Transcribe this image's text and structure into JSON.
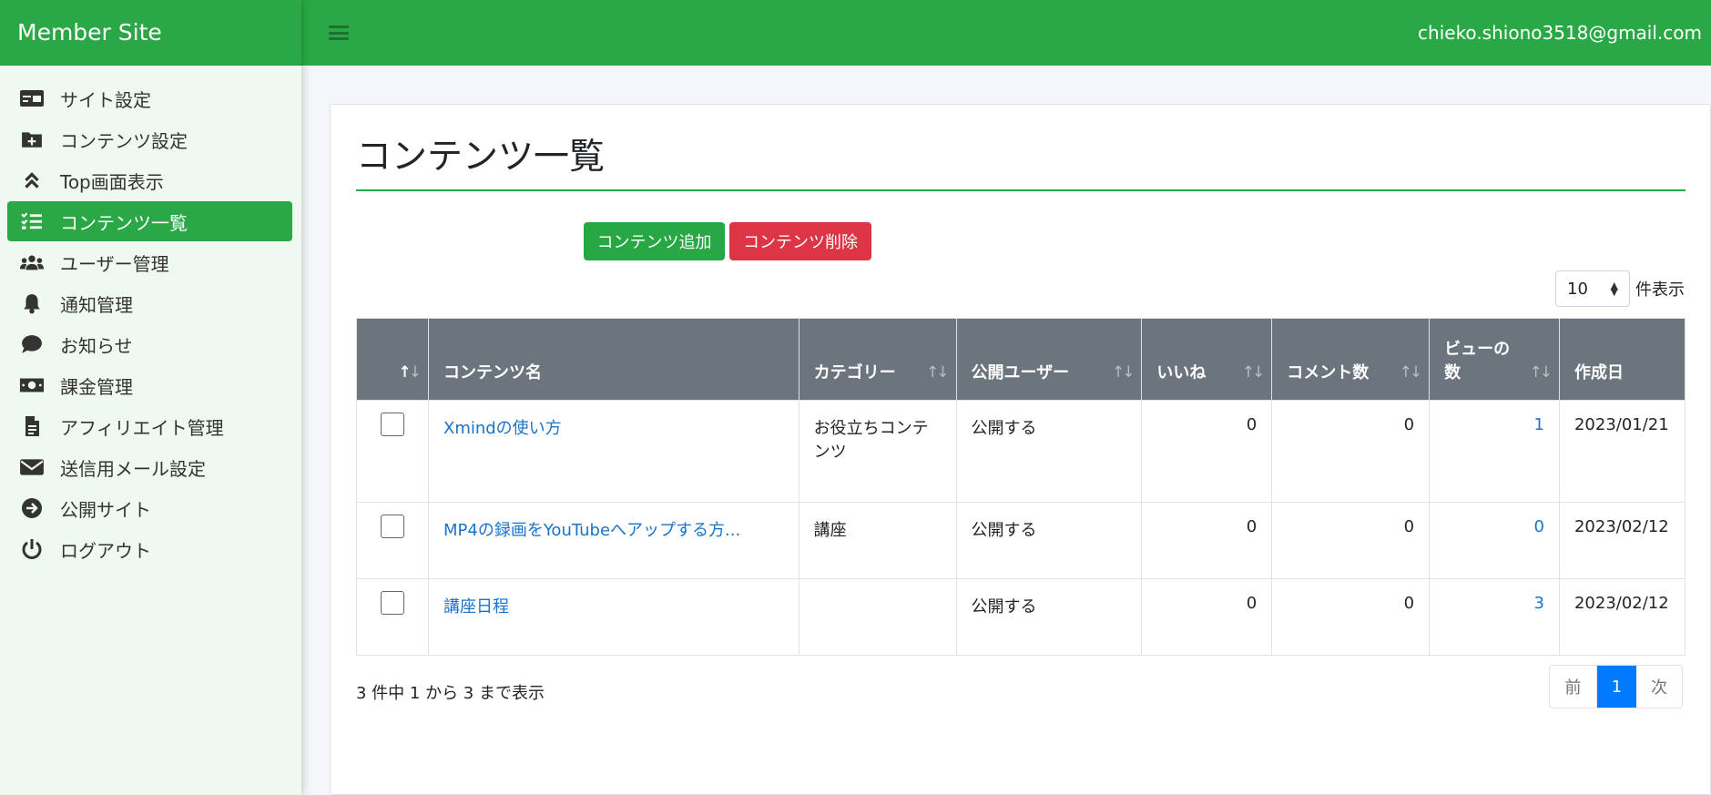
{
  "brand": "Member Site",
  "user_email": "chieko.shiono3518@gmail.com",
  "sidebar": {
    "items": [
      {
        "label": "サイト設定",
        "icon": "card-icon"
      },
      {
        "label": "コンテンツ設定",
        "icon": "folder-plus-icon"
      },
      {
        "label": "Top画面表示",
        "icon": "angles-up-icon"
      },
      {
        "label": "コンテンツ一覧",
        "icon": "list-check-icon",
        "active": true
      },
      {
        "label": "ユーザー管理",
        "icon": "users-icon"
      },
      {
        "label": "通知管理",
        "icon": "bell-icon"
      },
      {
        "label": "お知らせ",
        "icon": "comment-icon"
      },
      {
        "label": "課金管理",
        "icon": "money-icon"
      },
      {
        "label": "アフィリエイト管理",
        "icon": "file-icon"
      },
      {
        "label": "送信用メール設定",
        "icon": "envelope-icon"
      },
      {
        "label": "公開サイト",
        "icon": "arrow-circle-icon"
      },
      {
        "label": "ログアウト",
        "icon": "power-icon"
      }
    ]
  },
  "main": {
    "title": "コンテンツ一覧",
    "add_button": "コンテンツ追加",
    "delete_button": "コンテンツ削除",
    "page_length": "10",
    "page_length_label": "件表示",
    "columns": [
      "コンテンツ名",
      "カテゴリー",
      "公開ユーザー",
      "いいね",
      "コメント数",
      "ビューの数",
      "作成日"
    ],
    "column_view_line1": "ビューの",
    "column_view_line2": "数",
    "rows": [
      {
        "name": "Xmindの使い方",
        "category": "お役立ちコンテンツ",
        "publish": "公開する",
        "likes": "0",
        "comments": "0",
        "views": "1",
        "date": "2023/01/21"
      },
      {
        "name": "MP4の録画をYouTubeへアップする方...",
        "category": "講座",
        "publish": "公開する",
        "likes": "0",
        "comments": "0",
        "views": "0",
        "date": "2023/02/12"
      },
      {
        "name": "講座日程",
        "category": "",
        "publish": "公開する",
        "likes": "0",
        "comments": "0",
        "views": "3",
        "date": "2023/02/12"
      }
    ],
    "info": "3 件中 1 から 3 まで表示",
    "pager": {
      "prev": "前",
      "current": "1",
      "next": "次"
    }
  },
  "colors": {
    "primary": "#2aa845",
    "danger": "#dc3545",
    "header": "#6c757d",
    "link": "#1a73c8",
    "page_active": "#007bff"
  }
}
